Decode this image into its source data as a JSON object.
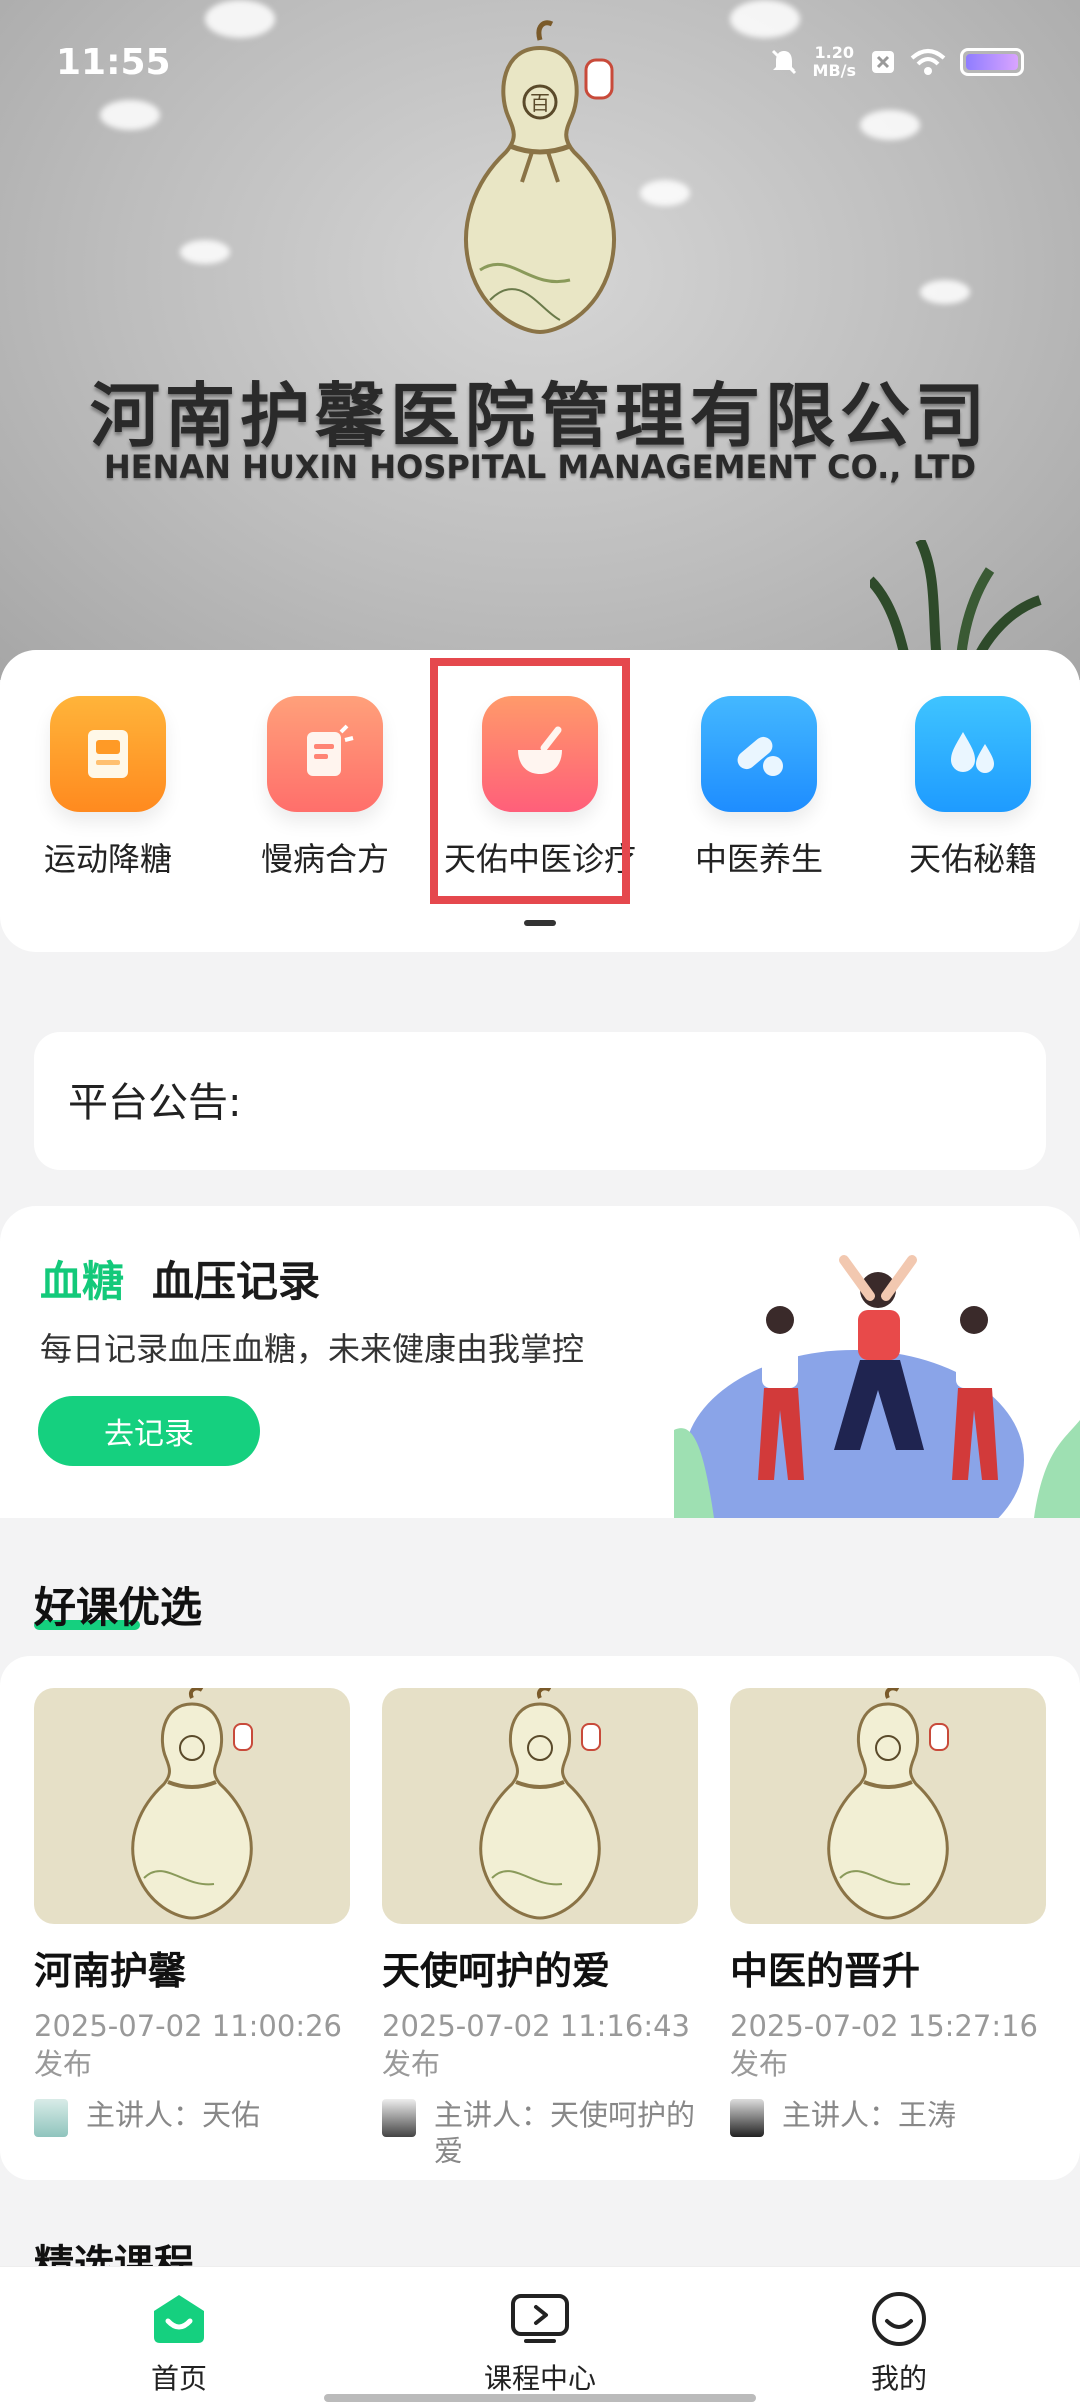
{
  "status_bar": {
    "time": "11:55",
    "net_speed_value": "1.20",
    "net_speed_unit": "MB/s"
  },
  "banner": {
    "company_cn": "河南护馨医院管理有限公司",
    "company_en": "HENAN HUXIN HOSPITAL MANAGEMENT CO., LTD",
    "logo_char": "百"
  },
  "menu": {
    "items": [
      {
        "label": "运动降糖",
        "icon": "book-icon",
        "color_from": "#ffb43a",
        "color_to": "#ff8a1f"
      },
      {
        "label": "慢病合方",
        "icon": "document-icon",
        "color_from": "#ffa07a",
        "color_to": "#ff6f6b"
      },
      {
        "label": "天佑中医诊疗",
        "icon": "mortar-icon",
        "color_from": "#ff9a6a",
        "color_to": "#ff5f7a"
      },
      {
        "label": "中医养生",
        "icon": "pill-icon",
        "color_from": "#44b8ff",
        "color_to": "#1e8dff"
      },
      {
        "label": "天佑秘籍",
        "icon": "water-drops-icon",
        "color_from": "#3fc4ff",
        "color_to": "#1e9bff"
      }
    ],
    "highlight_color": "#e5484d"
  },
  "notice": {
    "title": "平台公告:"
  },
  "record": {
    "title_highlight": "血糖",
    "title_rest": "血压记录",
    "subtitle": "每日记录血压血糖，未来健康由我掌控",
    "button_label": "去记录",
    "accent": "#15d07f"
  },
  "courses": {
    "section_title": "好课优选",
    "items": [
      {
        "name": "河南护馨",
        "date": "2025-07-02 11:00:26",
        "publish": "发布",
        "speaker_label": "主讲人：",
        "speaker": "天佑"
      },
      {
        "name": "天使呵护的爱",
        "date": "2025-07-02 11:16:43",
        "publish": "发布",
        "speaker_label": "主讲人：",
        "speaker": "天使呵护的爱"
      },
      {
        "name": "中医的晋升",
        "date": "2025-07-02 15:27:16",
        "publish": "发布",
        "speaker_label": "主讲人：",
        "speaker": "王涛"
      }
    ]
  },
  "featured": {
    "title": "精选课程"
  },
  "bottom_nav": {
    "items": [
      {
        "label": "首页",
        "icon": "home-icon",
        "active": true
      },
      {
        "label": "课程中心",
        "icon": "video-play-icon",
        "active": false
      },
      {
        "label": "我的",
        "icon": "smiley-profile-icon",
        "active": false
      }
    ]
  }
}
